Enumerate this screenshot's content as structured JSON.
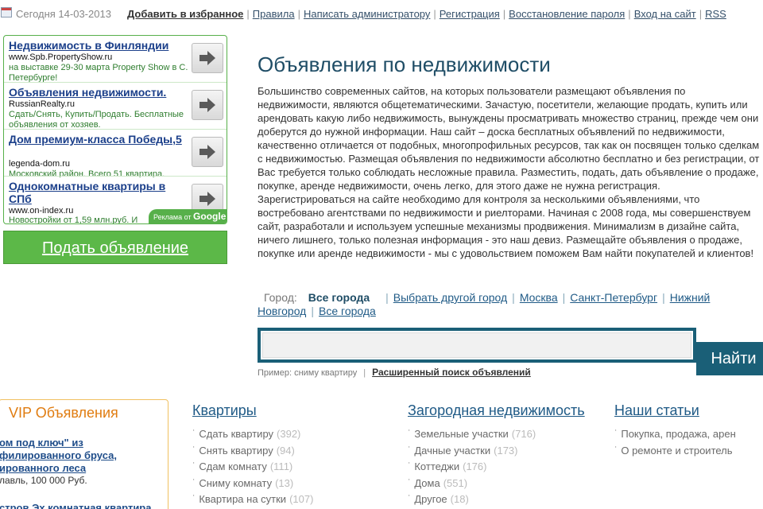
{
  "topbar": {
    "today": "Сегодня 14-03-2013",
    "links": [
      {
        "label": "Добавить в избранное",
        "bold": true
      },
      {
        "label": "Правила"
      },
      {
        "label": "Написать администратору"
      },
      {
        "label": "Регистрация"
      },
      {
        "label": "Восстановление пароля"
      },
      {
        "label": "Вход на сайт"
      },
      {
        "label": "RSS"
      }
    ]
  },
  "ads": {
    "items": [
      {
        "title": "Недвижимость в Финляндии",
        "url": "www.Spb.PropertyShow.ru",
        "desc": "на выставке 29-30 марта Property Show в С. Петербурге!"
      },
      {
        "title": "Объявления недвижимости.",
        "url": "RussianRealty.ru",
        "desc": "Сдать/Снять, Купить/Продать. Бесплатные объявления от хозяев."
      },
      {
        "title": "Дом премиум-класса Победы,5",
        "url": "legenda-dom.ru",
        "desc": "Московский район. Всего 51 квартира."
      },
      {
        "title": "Однокомнатные квартиры в СПб",
        "url": "www.on-index.ru",
        "desc": "Новостройки от 1,59 млн.руб. И"
      }
    ],
    "badge_text": "Реклама от",
    "badge_brand": "Google"
  },
  "submit_button": "Подать объявление",
  "main": {
    "title": "Объявления по недвижимости",
    "intro": "Большинство современных сайтов, на которых пользователи размещают объявления по недвижимости, являются общетематическими. Зачастую, посетители, желающие продать, купить или арендовать какую либо недвижимость, вынуждены просматривать множество страниц, прежде чем они доберутся до нужной информации. Наш сайт – доска бесплатных объявлений по недвижимости, качественно отличается от подобных, многопрофильных ресурсов, так как он посвящен только сделкам с недвижимостью. Размещая объявления по недвижимости абсолютно бесплатно и без регистрации, от Вас требуется только соблюдать несложные правила. Разместить, подать, дать объявление о продаже, покупке, аренде недвижимости, очень легко, для этого даже не нужна регистрация. Зарегистрироваться на сайте необходимо для контроля за несколькими объявлениями, что востребовано агентствами по недвижимости и риелторами. Начиная с 2008 года, мы совершенствуем сайт, разработали и используем успешные механизмы продвижения. Минимализм в дизайне сайта, ничего лишнего, только полезная информация - это наш девиз. Размещайте объявления о продаже, покупке или аренде недвижимости - мы с удовольствием поможем Вам найти покупателей и клиентов!"
  },
  "cities": {
    "label": "Город:",
    "current": "Все города",
    "links": [
      "Выбрать другой город",
      "Москва",
      "Санкт-Петербург",
      "Нижний Новгород",
      "Все города"
    ]
  },
  "search": {
    "placeholder": "",
    "button": "Найти",
    "example": "Пример: сниму квартиру",
    "advanced": "Расширенный поиск объявлений"
  },
  "vip": {
    "title": "VIP Объявления",
    "link": "ом под ключ\" из филированного бруса, ированного леса",
    "meta": "лавль, 100 000 Руб.",
    "link2": "стров Эх комнатная квартира"
  },
  "columns": [
    {
      "heading": "Квартиры",
      "items": [
        {
          "label": "Сдать квартиру",
          "count": "(392)"
        },
        {
          "label": "Снять квартиру",
          "count": "(94)"
        },
        {
          "label": "Сдам комнату",
          "count": "(111)"
        },
        {
          "label": "Сниму комнату",
          "count": "(13)"
        },
        {
          "label": "Квартира на сутки",
          "count": "(107)"
        }
      ]
    },
    {
      "heading": "Загородная недвижимость",
      "items": [
        {
          "label": "Земельные участки",
          "count": "(716)"
        },
        {
          "label": "Дачные участки",
          "count": "(173)"
        },
        {
          "label": "Коттеджи",
          "count": "(176)"
        },
        {
          "label": "Дома",
          "count": "(551)"
        },
        {
          "label": "Другое",
          "count": "(18)"
        }
      ]
    },
    {
      "heading": "Наши статьи",
      "items": [
        {
          "label": "Покупка, продажа, арен",
          "count": ""
        },
        {
          "label": "О ремонте и строитель",
          "count": ""
        }
      ]
    }
  ]
}
